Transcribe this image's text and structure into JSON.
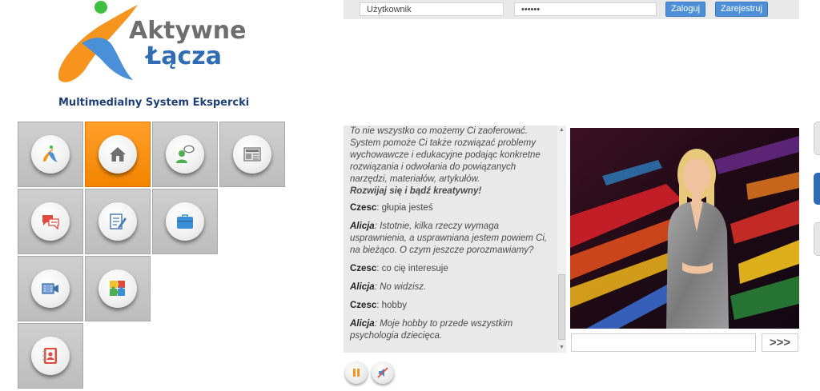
{
  "logo": {
    "line1": "Aktywne",
    "line2": "Łącza",
    "subtitle": "Multimedialny System Ekspercki"
  },
  "login": {
    "username_value": "Użytkownik",
    "password_value": "••••••",
    "login_label": "Zaloguj",
    "register_label": "Zarejestruj"
  },
  "tiles": [
    {
      "icon": "logo-icon"
    },
    {
      "icon": "home-icon",
      "active": true
    },
    {
      "icon": "consultant-icon"
    },
    {
      "icon": "news-icon"
    },
    {
      "icon": "chat-bubbles-icon"
    },
    {
      "icon": "edit-document-icon"
    },
    {
      "icon": "briefcase-icon"
    },
    {
      "icon": "video-icon"
    },
    {
      "icon": "puzzle-icon"
    },
    {
      "icon": "contacts-book-icon"
    }
  ],
  "chat": {
    "intro": "To nie wszystko co możemy Ci zaoferować. System pomoże Ci także rozwiązać problemy wychowawcze i edukacyjne podając konkretne rozwiązania i odwołania do powiązanych narzędzi, materiałów, artykułów.",
    "intro_strong": "Rozwijaj się i bądź kreatywny!",
    "messages": [
      {
        "speaker": "Czesc",
        "text": ": głupia jesteś"
      },
      {
        "speaker": "Alicja",
        "text": ": Istotnie, kilka rzeczy wymaga usprawnienia, a usprawniana jestem powiem Ci, na bieżąco. O czym jeszcze porozmawiamy?"
      },
      {
        "speaker": "Czesc",
        "text": ": co cię interesuje"
      },
      {
        "speaker": "Alicja",
        "text": ": No widzisz."
      },
      {
        "speaker": "Czesc",
        "text": ": hobby"
      },
      {
        "speaker": "Alicja",
        "text": ": Moje hobby to przede wszystkim psychologia dziecięca."
      }
    ],
    "input_value": "",
    "send_label": ">>>"
  },
  "colors": {
    "accent_orange": "#f28400",
    "accent_blue": "#4d8fd8",
    "logo_gray": "#6e6e6e",
    "logo_blue": "#2f6cb5",
    "subtitle_navy": "#1e3f78",
    "tile_gray": "#c4c4c4"
  }
}
